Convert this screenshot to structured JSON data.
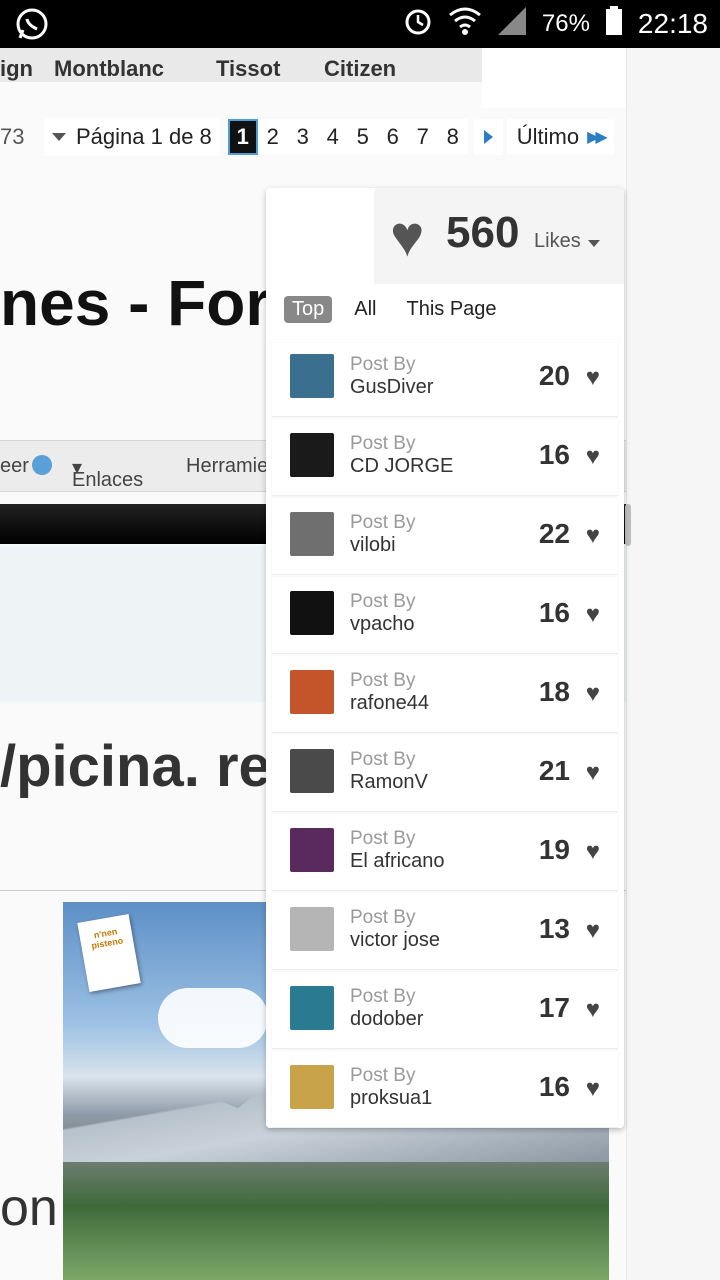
{
  "statusbar": {
    "battery": "76%",
    "time": "22:18"
  },
  "brands": [
    "ign",
    "Montblanc",
    "Tissot",
    "Citizen"
  ],
  "pager": {
    "prev_num": "73",
    "label": "Página 1 de 8",
    "pages": [
      "1",
      "2",
      "3",
      "4",
      "5",
      "6",
      "7",
      "8"
    ],
    "last": "Último"
  },
  "title_partial": "nes - Forc",
  "navbar": {
    "item1": "eer",
    "item2": "Enlaces",
    "item3": "Herramie"
  },
  "thread_title_partial": "/picina. re",
  "body_partial": "on",
  "ad": {
    "badge_text": "n'nen pisteno"
  },
  "likes": {
    "count": "560",
    "label": "Likes",
    "tabs": [
      "Top",
      "All",
      "This Page"
    ],
    "post_by_label": "Post By",
    "items": [
      {
        "user": "GusDiver",
        "count": "20",
        "avatar_color": "#3b6f8f"
      },
      {
        "user": "CD JORGE",
        "count": "16",
        "avatar_color": "#1a1a1a"
      },
      {
        "user": "vilobi",
        "count": "22",
        "avatar_color": "#6f6f6f"
      },
      {
        "user": "vpacho",
        "count": "16",
        "avatar_color": "#111111"
      },
      {
        "user": "rafone44",
        "count": "18",
        "avatar_color": "#c4552b"
      },
      {
        "user": "RamonV",
        "count": "21",
        "avatar_color": "#4a4a4a"
      },
      {
        "user": "El africano",
        "count": "19",
        "avatar_color": "#5a2a5e"
      },
      {
        "user": "victor jose",
        "count": "13",
        "avatar_color": "#b5b5b5"
      },
      {
        "user": "dodober",
        "count": "17",
        "avatar_color": "#2a7a92"
      },
      {
        "user": "proksua1",
        "count": "16",
        "avatar_color": "#c9a34a"
      }
    ]
  }
}
